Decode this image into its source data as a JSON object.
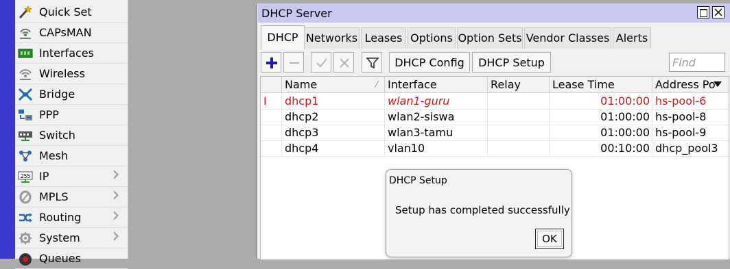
{
  "sidebar": {
    "items": [
      {
        "label": "Quick Set",
        "icon": "quick-set-icon",
        "submenu": false
      },
      {
        "label": "CAPsMAN",
        "icon": "capsman-icon",
        "submenu": false
      },
      {
        "label": "Interfaces",
        "icon": "interfaces-icon",
        "submenu": false
      },
      {
        "label": "Wireless",
        "icon": "wireless-icon",
        "submenu": false
      },
      {
        "label": "Bridge",
        "icon": "bridge-icon",
        "submenu": false
      },
      {
        "label": "PPP",
        "icon": "ppp-icon",
        "submenu": false
      },
      {
        "label": "Switch",
        "icon": "switch-icon",
        "submenu": false
      },
      {
        "label": "Mesh",
        "icon": "mesh-icon",
        "submenu": false
      },
      {
        "label": "IP",
        "icon": "ip-icon",
        "submenu": true,
        "icon_text": "255"
      },
      {
        "label": "MPLS",
        "icon": "mpls-icon",
        "submenu": true
      },
      {
        "label": "Routing",
        "icon": "routing-icon",
        "submenu": true
      },
      {
        "label": "System",
        "icon": "system-icon",
        "submenu": true
      },
      {
        "label": "Queues",
        "icon": "queues-icon",
        "submenu": false
      }
    ]
  },
  "window": {
    "title": "DHCP Server",
    "tabs": [
      "DHCP",
      "Networks",
      "Leases",
      "Options",
      "Option Sets",
      "Vendor Classes",
      "Alerts"
    ],
    "active_tab": "DHCP",
    "toolbar": {
      "add_icon": "plus-icon",
      "remove_icon": "minus-icon",
      "enable_icon": "check-icon",
      "disable_icon": "x-icon",
      "filter_icon": "filter-icon",
      "config_label": "DHCP Config",
      "setup_label": "DHCP Setup",
      "find_placeholder": "Find"
    },
    "table": {
      "columns": [
        "Name",
        "Interface",
        "Relay",
        "Lease Time",
        "Address Po"
      ],
      "rows": [
        {
          "flag": "I",
          "name": "dhcp1",
          "interface": "wlan1-guru",
          "relay": "",
          "lease_time": "01:00:00",
          "address_pool": "hs-pool-6",
          "disabled": true
        },
        {
          "flag": "",
          "name": "dhcp2",
          "interface": "wlan2-siswa",
          "relay": "",
          "lease_time": "01:00:00",
          "address_pool": "hs-pool-8",
          "disabled": false
        },
        {
          "flag": "",
          "name": "dhcp3",
          "interface": "wlan3-tamu",
          "relay": "",
          "lease_time": "01:00:00",
          "address_pool": "hs-pool-9",
          "disabled": false
        },
        {
          "flag": "",
          "name": "dhcp4",
          "interface": "vlan10",
          "relay": "",
          "lease_time": "00:10:00",
          "address_pool": "dhcp_pool3",
          "disabled": false
        }
      ]
    }
  },
  "dialog": {
    "title": "DHCP Setup",
    "message": "Setup has completed successfully",
    "ok_label": "OK"
  },
  "colors": {
    "left_strip": "#3a3ad0",
    "titlebar": "#c8c8f0",
    "disabled_row": "#d01818",
    "add_icon": "#1a1ab0"
  }
}
